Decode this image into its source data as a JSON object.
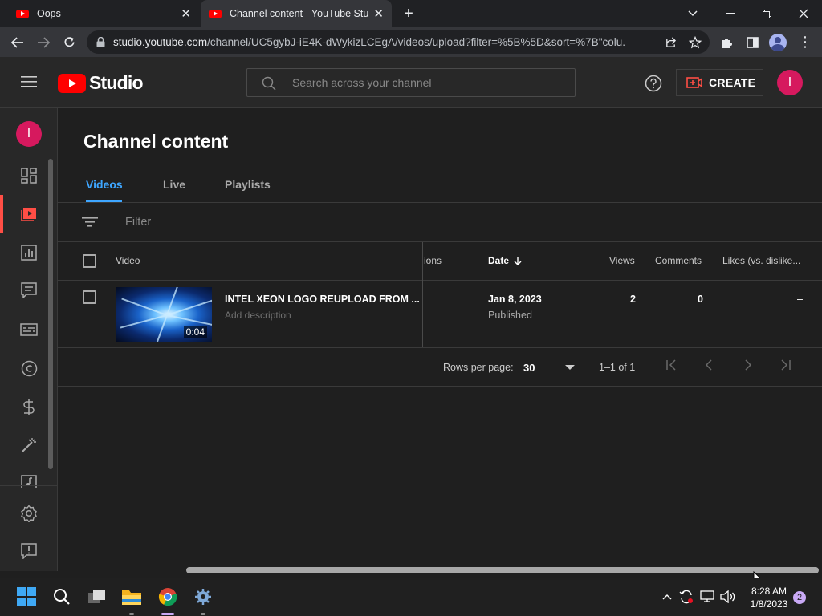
{
  "browser": {
    "tabs": [
      {
        "title": "Oops",
        "active": false
      },
      {
        "title": "Channel content - YouTube Studio",
        "active": true
      }
    ],
    "url_host": "studio.youtube.com",
    "url_path": "/channel/UC5gybJ-iE4K-dWykizLCEgA/videos/upload?filter=%5B%5D&sort=%7B\"colu..."
  },
  "studio": {
    "logo_text": "Studio",
    "search_placeholder": "Search across your channel",
    "create_label": "CREATE",
    "avatar_letter": "I"
  },
  "page": {
    "title": "Channel content",
    "tabs": [
      "Videos",
      "Live",
      "Playlists"
    ],
    "filter_label": "Filter"
  },
  "table": {
    "columns": {
      "video": "Video",
      "restrictions": "ions",
      "date": "Date",
      "views": "Views",
      "comments": "Comments",
      "likes": "Likes (vs. dislike..."
    },
    "rows": [
      {
        "title": "INTEL XEON LOGO REUPLOAD FROM ...",
        "description": "Add description",
        "duration": "0:04",
        "date": "Jan 8, 2023",
        "status": "Published",
        "views": "2",
        "comments": "0",
        "likes": "–"
      }
    ]
  },
  "pagination": {
    "rows_per_page_label": "Rows per page:",
    "rows_per_page_value": "30",
    "range": "1–1 of 1"
  },
  "taskbar": {
    "time": "8:28 AM",
    "date": "1/8/2023",
    "notifications": "2"
  },
  "colors": {
    "accent_blue": "#3ea6ff",
    "youtube_red": "#ff0000",
    "avatar": "#d6195e"
  }
}
